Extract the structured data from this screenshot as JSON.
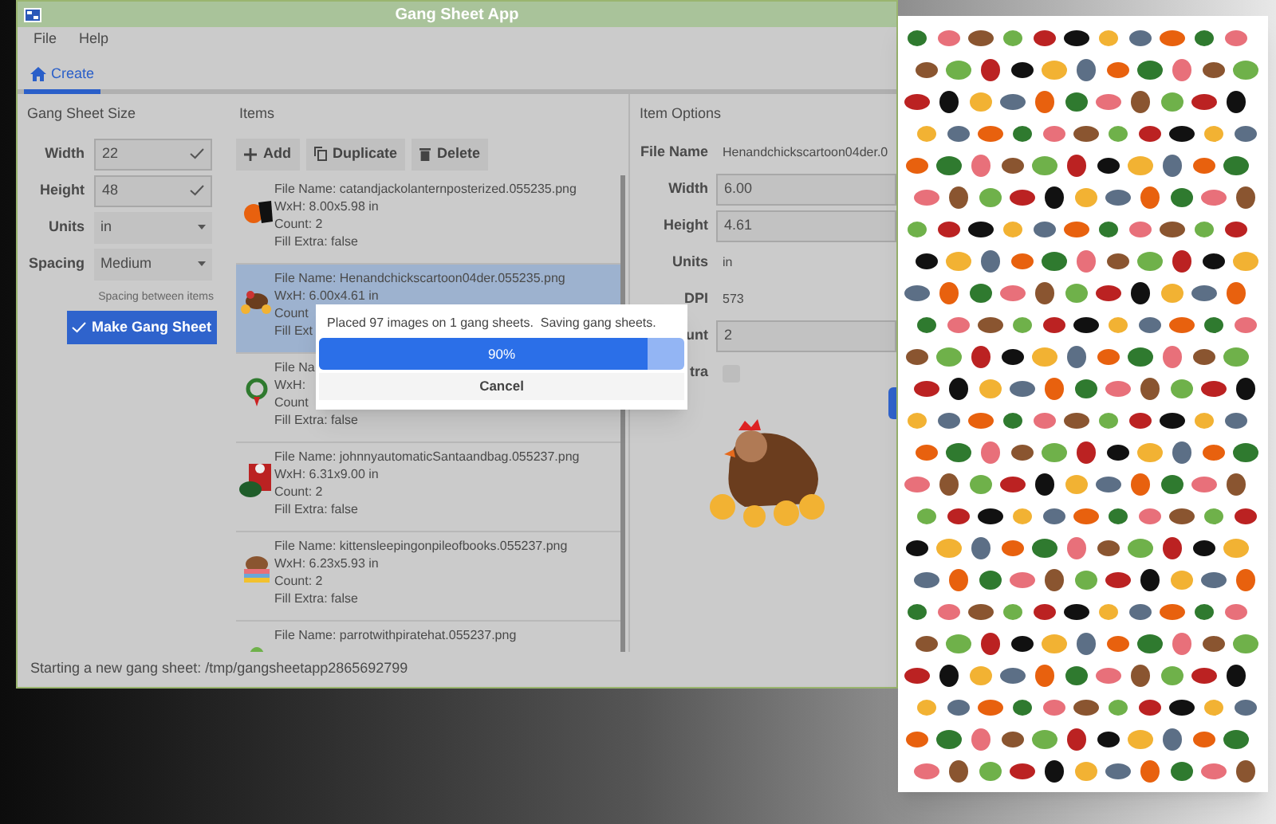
{
  "window": {
    "title": "Gang Sheet App"
  },
  "menu": [
    {
      "label": "File"
    },
    {
      "label": "Help"
    }
  ],
  "tabs": [
    {
      "label": "Create",
      "selected": true
    }
  ],
  "sheet_size": {
    "title": "Gang Sheet Size",
    "fields": [
      {
        "kind": "entry",
        "label": "Width",
        "value": "22"
      },
      {
        "kind": "entry",
        "label": "Height",
        "value": "48"
      },
      {
        "kind": "select",
        "label": "Units",
        "value": "in"
      },
      {
        "kind": "select",
        "label": "Spacing",
        "value": "Medium",
        "hint": "Spacing between items"
      }
    ],
    "button": "Make Gang Sheet"
  },
  "items": {
    "title": "Items",
    "buttons": [
      {
        "kind": "add",
        "label": "Add"
      },
      {
        "kind": "duplicate",
        "label": "Duplicate"
      },
      {
        "kind": "delete",
        "label": "Delete"
      }
    ],
    "list": [
      {
        "selected": false,
        "lines": [
          "File Name: catandjackolanternposterized.055235.png",
          "WxH: 8.00x5.98 in",
          "Count: 2",
          "Fill Extra: false"
        ]
      },
      {
        "selected": true,
        "lines": [
          "File Name: Henandchickscartoon04der.055235.png",
          "WxH: 6.00x4.61 in",
          "Count",
          "Fill Ext"
        ]
      },
      {
        "selected": false,
        "lines": [
          "File Na",
          "WxH:",
          "Count",
          "Fill Extra: false"
        ]
      },
      {
        "selected": false,
        "lines": [
          "File Name: johnnyautomaticSantaandbag.055237.png",
          "WxH: 6.31x9.00 in",
          "Count: 2",
          "Fill Extra: false"
        ]
      },
      {
        "selected": false,
        "lines": [
          "File Name: kittensleepingonpileofbooks.055237.png",
          "WxH: 6.23x5.93 in",
          "Count: 2",
          "Fill Extra: false"
        ]
      },
      {
        "selected": false,
        "lines": [
          "File Name: parrotwithpiratehat.055237.png"
        ]
      }
    ]
  },
  "item_options": {
    "title": "Item Options",
    "rows": [
      {
        "kind": "text",
        "label": "File Name",
        "value": "Henandchickscartoon04der.0"
      },
      {
        "kind": "entry",
        "label": "Width",
        "value": "6.00"
      },
      {
        "kind": "entry",
        "label": "Height",
        "value": "4.61"
      },
      {
        "kind": "text",
        "label": "Units",
        "value": "in"
      },
      {
        "kind": "text",
        "label": "DPI",
        "value": "573"
      },
      {
        "kind": "entry",
        "label": "unt",
        "value": "2"
      },
      {
        "kind": "checkbox",
        "label": "tra",
        "checked": false
      }
    ]
  },
  "dialog": {
    "message": "Placed 97 images on 1 gang sheets.  Saving gang sheets.",
    "progress": {
      "level": 0.9,
      "reading": "90%"
    },
    "button": "Cancel"
  },
  "status_bar": "Starting a new gang sheet: /tmp/gangsheetapp2865692799"
}
